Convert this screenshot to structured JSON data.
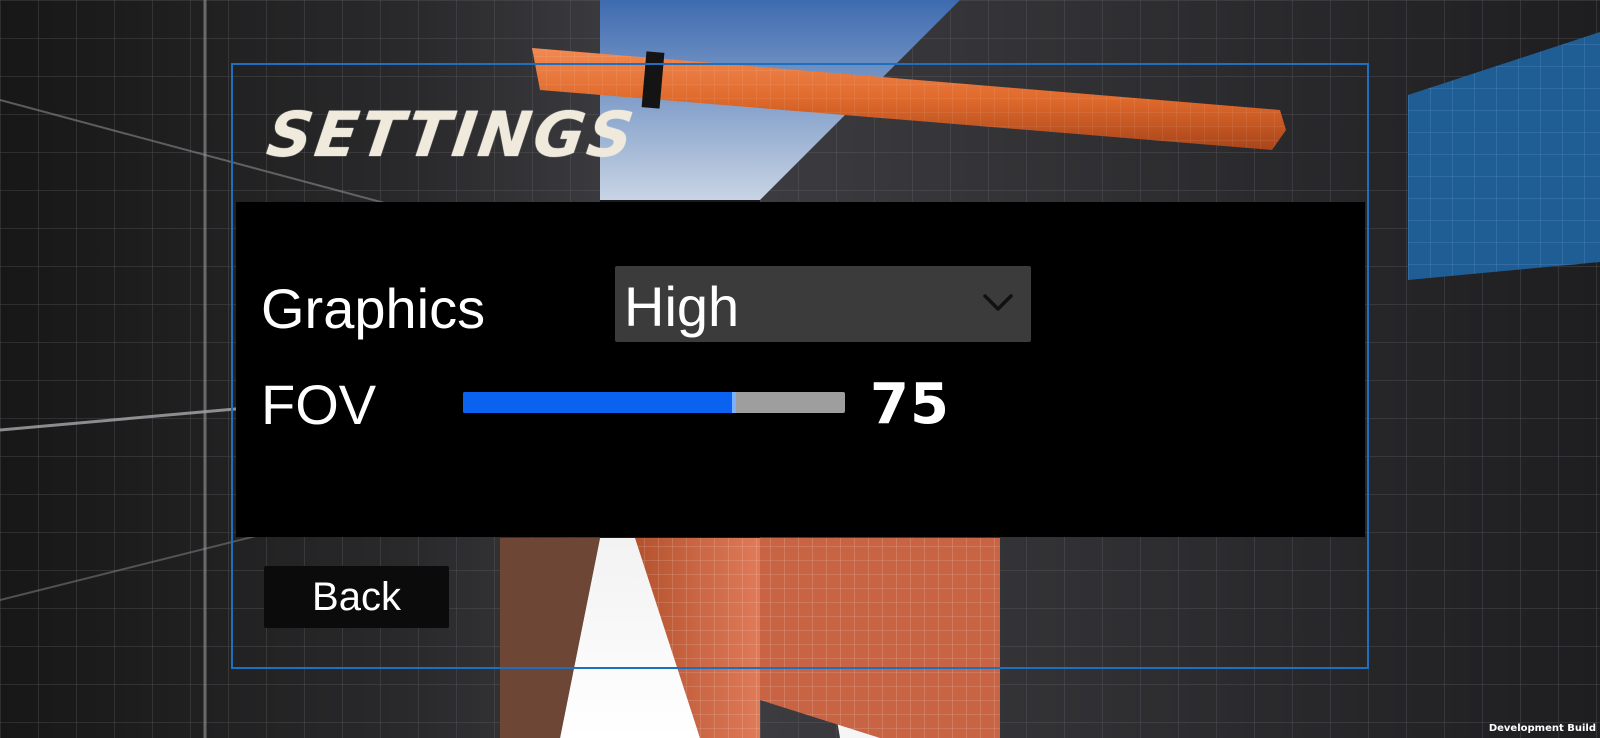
{
  "menu": {
    "title": "Settings"
  },
  "settings": {
    "graphics": {
      "label": "Graphics",
      "selected": "High"
    },
    "fov": {
      "label": "FOV",
      "value": "75",
      "fill_fraction": 0.71
    }
  },
  "actions": {
    "back_label": "Back"
  },
  "footer": {
    "build_label": "Development Build"
  },
  "colors": {
    "frame_border": "#1e6fc0",
    "slider_fill": "#0a63f0",
    "slider_track": "#9e9e9e",
    "dropdown_bg": "#3b3b3b",
    "panel_bg": "#000000"
  },
  "icons": {
    "dropdown_arrow": "chevron-down-icon"
  }
}
